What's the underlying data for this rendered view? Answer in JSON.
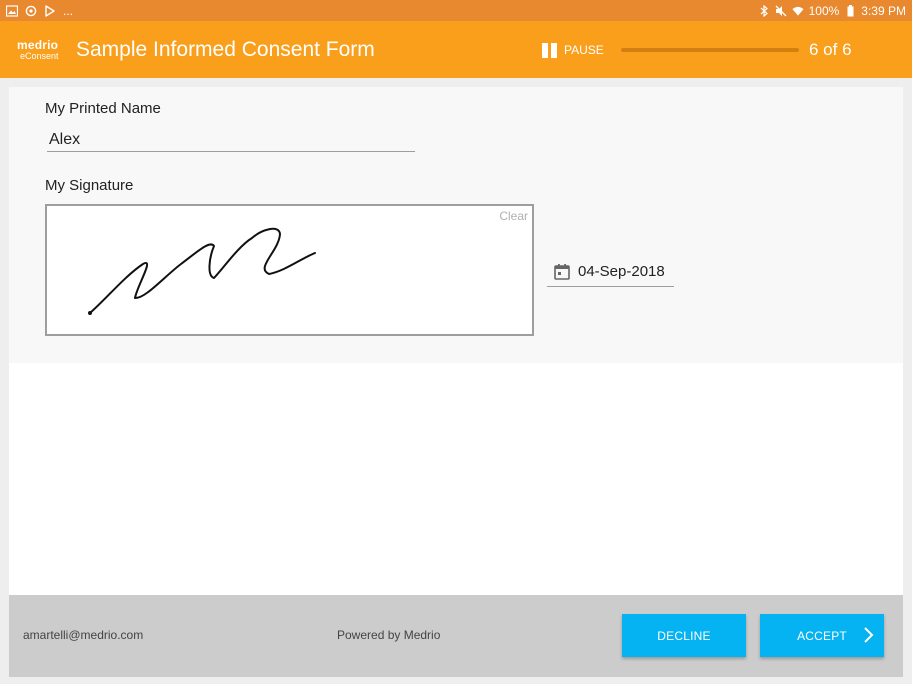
{
  "status_bar": {
    "overflow": "...",
    "battery": "100%",
    "time": "3:39 PM"
  },
  "app_bar": {
    "logo_line1": "medrio",
    "logo_line2": "eConsent",
    "title": "Sample Informed Consent Form",
    "pause_label": "PAUSE",
    "progress_fraction": 1.0,
    "page_counter": "6 of 6",
    "brand_color": "#f99f1b"
  },
  "form": {
    "printed_name_label": "My Printed Name",
    "printed_name_value": "Alex",
    "signature_label": "My Signature",
    "clear_label": "Clear",
    "date_value": "04-Sep-2018"
  },
  "footer": {
    "email": "amartelli@medrio.com",
    "powered_by": "Powered by Medrio",
    "decline_label": "DECLINE",
    "accept_label": "ACCEPT",
    "button_color": "#05b2f2"
  }
}
